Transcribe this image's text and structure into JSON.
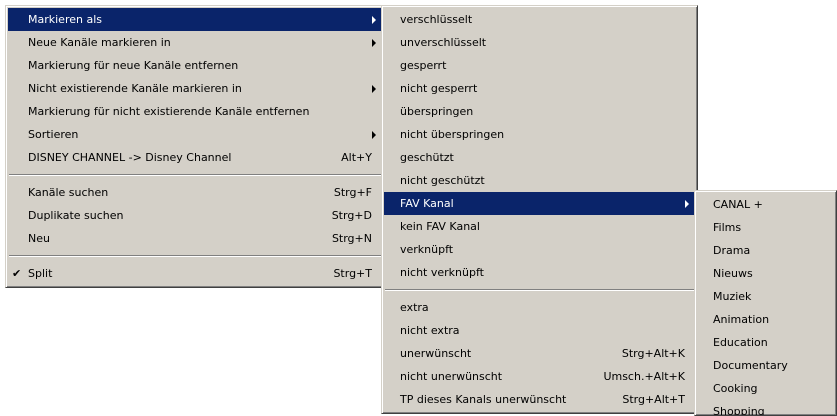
{
  "menu_main": {
    "items": [
      {
        "label": "Markieren als",
        "shortcut": "",
        "submenu": true,
        "selected": true
      },
      {
        "label": "Neue Kanäle markieren in",
        "shortcut": "",
        "submenu": true
      },
      {
        "label": "Markierung für neue Kanäle entfernen",
        "shortcut": ""
      },
      {
        "label": "Nicht existierende Kanäle markieren in",
        "shortcut": "",
        "submenu": true
      },
      {
        "label": "Markierung für nicht existierende Kanäle entfernen",
        "shortcut": ""
      },
      {
        "label": "Sortieren",
        "shortcut": "",
        "submenu": true
      },
      {
        "label": "DISNEY CHANNEL -> Disney Channel",
        "shortcut": "Alt+Y"
      },
      {
        "label": "Kanäle suchen",
        "shortcut": "Strg+F"
      },
      {
        "label": "Duplikate suchen",
        "shortcut": "Strg+D"
      },
      {
        "label": "Neu",
        "shortcut": "Strg+N"
      },
      {
        "label": "Split",
        "shortcut": "Strg+T",
        "checked": true
      }
    ]
  },
  "menu_markieren_als": {
    "items": [
      {
        "label": "verschlüsselt",
        "shortcut": ""
      },
      {
        "label": "unverschlüsselt",
        "shortcut": ""
      },
      {
        "label": "gesperrt",
        "shortcut": ""
      },
      {
        "label": "nicht gesperrt",
        "shortcut": ""
      },
      {
        "label": "überspringen",
        "shortcut": ""
      },
      {
        "label": "nicht überspringen",
        "shortcut": ""
      },
      {
        "label": "geschützt",
        "shortcut": ""
      },
      {
        "label": "nicht geschützt",
        "shortcut": ""
      },
      {
        "label": "FAV Kanal",
        "shortcut": "",
        "submenu": true,
        "selected": true
      },
      {
        "label": "kein FAV Kanal",
        "shortcut": ""
      },
      {
        "label": "verknüpft",
        "shortcut": ""
      },
      {
        "label": "nicht verknüpft",
        "shortcut": ""
      },
      {
        "label": "extra",
        "shortcut": ""
      },
      {
        "label": "nicht extra",
        "shortcut": ""
      },
      {
        "label": "unerwünscht",
        "shortcut": "Strg+Alt+K"
      },
      {
        "label": "nicht unerwünscht",
        "shortcut": "Umsch.+Alt+K"
      },
      {
        "label": "TP dieses Kanals unerwünscht",
        "shortcut": "Strg+Alt+T"
      }
    ]
  },
  "menu_fav_kanal": {
    "items": [
      {
        "label": "CANAL +"
      },
      {
        "label": "Films"
      },
      {
        "label": "Drama"
      },
      {
        "label": "Nieuws"
      },
      {
        "label": "Muziek"
      },
      {
        "label": "Animation"
      },
      {
        "label": "Education"
      },
      {
        "label": "Documentary"
      },
      {
        "label": "Cooking"
      },
      {
        "label": "Shopping"
      }
    ]
  },
  "check_glyph": "✔"
}
